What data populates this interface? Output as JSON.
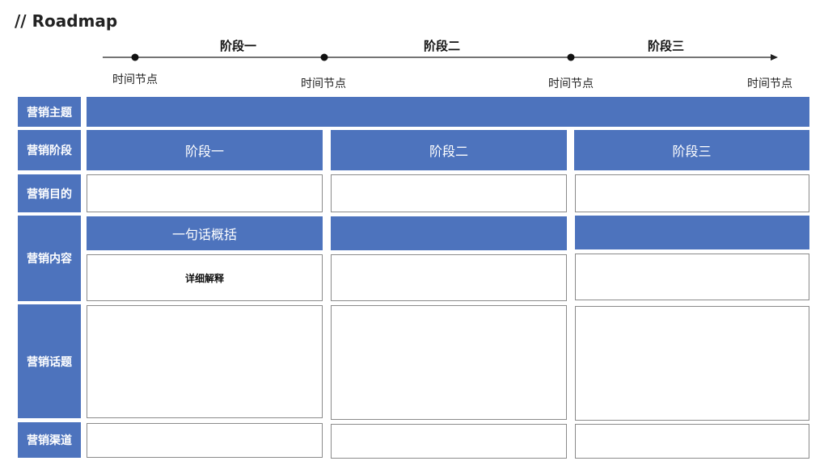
{
  "title": "// Roadmap",
  "timeline": {
    "stages": [
      "阶段一",
      "阶段二",
      "阶段三"
    ],
    "node_labels": [
      "时间节点",
      "时间节点",
      "时间节点",
      "时间节点"
    ]
  },
  "row_labels": {
    "theme": "营销主题",
    "phase": "营销阶段",
    "goal": "营销目的",
    "content": "营销内容",
    "topic": "营销话题",
    "channel": "营销渠道"
  },
  "phase_headers": [
    "阶段一",
    "阶段二",
    "阶段三"
  ],
  "content": {
    "summary": "一句话概括",
    "detail": "详细解释"
  },
  "colors": {
    "accent_blue": "#4d73bd",
    "border_gray": "#8a8a8a"
  }
}
